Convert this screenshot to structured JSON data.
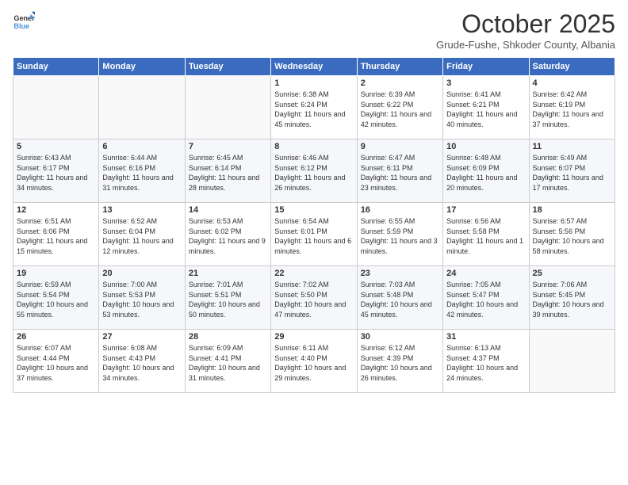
{
  "header": {
    "logo_general": "General",
    "logo_blue": "Blue",
    "title": "October 2025",
    "subtitle": "Grude-Fushe, Shkoder County, Albania"
  },
  "calendar": {
    "days_of_week": [
      "Sunday",
      "Monday",
      "Tuesday",
      "Wednesday",
      "Thursday",
      "Friday",
      "Saturday"
    ],
    "weeks": [
      [
        {
          "day": "",
          "info": ""
        },
        {
          "day": "",
          "info": ""
        },
        {
          "day": "",
          "info": ""
        },
        {
          "day": "1",
          "info": "Sunrise: 6:38 AM\nSunset: 6:24 PM\nDaylight: 11 hours and 45 minutes."
        },
        {
          "day": "2",
          "info": "Sunrise: 6:39 AM\nSunset: 6:22 PM\nDaylight: 11 hours and 42 minutes."
        },
        {
          "day": "3",
          "info": "Sunrise: 6:41 AM\nSunset: 6:21 PM\nDaylight: 11 hours and 40 minutes."
        },
        {
          "day": "4",
          "info": "Sunrise: 6:42 AM\nSunset: 6:19 PM\nDaylight: 11 hours and 37 minutes."
        }
      ],
      [
        {
          "day": "5",
          "info": "Sunrise: 6:43 AM\nSunset: 6:17 PM\nDaylight: 11 hours and 34 minutes."
        },
        {
          "day": "6",
          "info": "Sunrise: 6:44 AM\nSunset: 6:16 PM\nDaylight: 11 hours and 31 minutes."
        },
        {
          "day": "7",
          "info": "Sunrise: 6:45 AM\nSunset: 6:14 PM\nDaylight: 11 hours and 28 minutes."
        },
        {
          "day": "8",
          "info": "Sunrise: 6:46 AM\nSunset: 6:12 PM\nDaylight: 11 hours and 26 minutes."
        },
        {
          "day": "9",
          "info": "Sunrise: 6:47 AM\nSunset: 6:11 PM\nDaylight: 11 hours and 23 minutes."
        },
        {
          "day": "10",
          "info": "Sunrise: 6:48 AM\nSunset: 6:09 PM\nDaylight: 11 hours and 20 minutes."
        },
        {
          "day": "11",
          "info": "Sunrise: 6:49 AM\nSunset: 6:07 PM\nDaylight: 11 hours and 17 minutes."
        }
      ],
      [
        {
          "day": "12",
          "info": "Sunrise: 6:51 AM\nSunset: 6:06 PM\nDaylight: 11 hours and 15 minutes."
        },
        {
          "day": "13",
          "info": "Sunrise: 6:52 AM\nSunset: 6:04 PM\nDaylight: 11 hours and 12 minutes."
        },
        {
          "day": "14",
          "info": "Sunrise: 6:53 AM\nSunset: 6:02 PM\nDaylight: 11 hours and 9 minutes."
        },
        {
          "day": "15",
          "info": "Sunrise: 6:54 AM\nSunset: 6:01 PM\nDaylight: 11 hours and 6 minutes."
        },
        {
          "day": "16",
          "info": "Sunrise: 6:55 AM\nSunset: 5:59 PM\nDaylight: 11 hours and 3 minutes."
        },
        {
          "day": "17",
          "info": "Sunrise: 6:56 AM\nSunset: 5:58 PM\nDaylight: 11 hours and 1 minute."
        },
        {
          "day": "18",
          "info": "Sunrise: 6:57 AM\nSunset: 5:56 PM\nDaylight: 10 hours and 58 minutes."
        }
      ],
      [
        {
          "day": "19",
          "info": "Sunrise: 6:59 AM\nSunset: 5:54 PM\nDaylight: 10 hours and 55 minutes."
        },
        {
          "day": "20",
          "info": "Sunrise: 7:00 AM\nSunset: 5:53 PM\nDaylight: 10 hours and 53 minutes."
        },
        {
          "day": "21",
          "info": "Sunrise: 7:01 AM\nSunset: 5:51 PM\nDaylight: 10 hours and 50 minutes."
        },
        {
          "day": "22",
          "info": "Sunrise: 7:02 AM\nSunset: 5:50 PM\nDaylight: 10 hours and 47 minutes."
        },
        {
          "day": "23",
          "info": "Sunrise: 7:03 AM\nSunset: 5:48 PM\nDaylight: 10 hours and 45 minutes."
        },
        {
          "day": "24",
          "info": "Sunrise: 7:05 AM\nSunset: 5:47 PM\nDaylight: 10 hours and 42 minutes."
        },
        {
          "day": "25",
          "info": "Sunrise: 7:06 AM\nSunset: 5:45 PM\nDaylight: 10 hours and 39 minutes."
        }
      ],
      [
        {
          "day": "26",
          "info": "Sunrise: 6:07 AM\nSunset: 4:44 PM\nDaylight: 10 hours and 37 minutes."
        },
        {
          "day": "27",
          "info": "Sunrise: 6:08 AM\nSunset: 4:43 PM\nDaylight: 10 hours and 34 minutes."
        },
        {
          "day": "28",
          "info": "Sunrise: 6:09 AM\nSunset: 4:41 PM\nDaylight: 10 hours and 31 minutes."
        },
        {
          "day": "29",
          "info": "Sunrise: 6:11 AM\nSunset: 4:40 PM\nDaylight: 10 hours and 29 minutes."
        },
        {
          "day": "30",
          "info": "Sunrise: 6:12 AM\nSunset: 4:39 PM\nDaylight: 10 hours and 26 minutes."
        },
        {
          "day": "31",
          "info": "Sunrise: 6:13 AM\nSunset: 4:37 PM\nDaylight: 10 hours and 24 minutes."
        },
        {
          "day": "",
          "info": ""
        }
      ]
    ]
  }
}
